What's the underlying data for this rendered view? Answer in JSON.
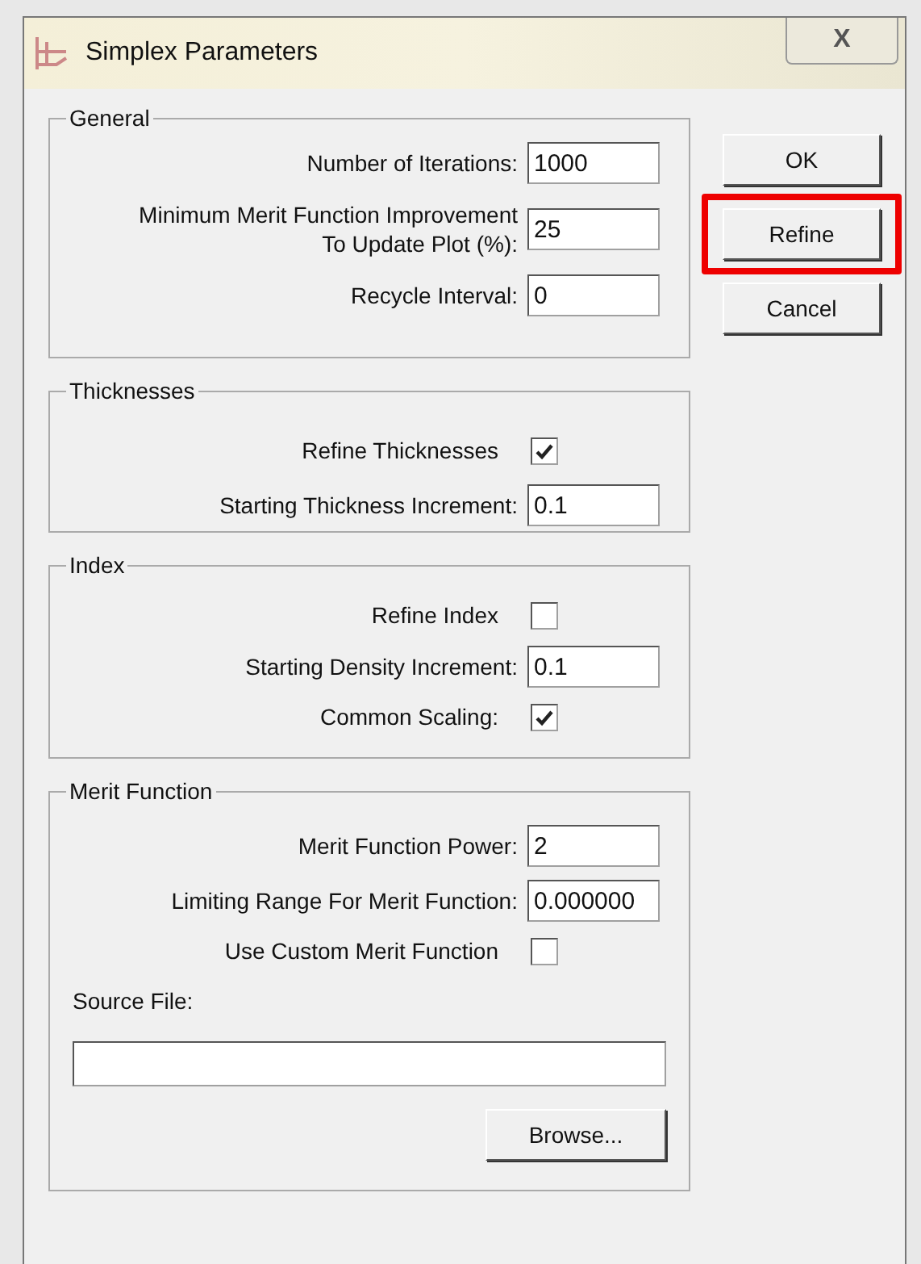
{
  "window": {
    "title": "Simplex Parameters",
    "close": "X"
  },
  "groups": [
    {
      "title": "General",
      "rows": [
        {
          "kind": "text",
          "label": "Number of Iterations:",
          "value": "1000"
        },
        {
          "kind": "text",
          "label": "Minimum Merit Function Improvement To Update Plot (%):",
          "value": "25"
        },
        {
          "kind": "text",
          "label": "Recycle Interval:",
          "value": "0"
        }
      ]
    },
    {
      "title": "Thicknesses",
      "rows": [
        {
          "kind": "checkbox",
          "label": "Refine Thicknesses",
          "checked": true
        },
        {
          "kind": "text",
          "label": "Starting Thickness Increment:",
          "value": "0.1"
        }
      ]
    },
    {
      "title": "Index",
      "rows": [
        {
          "kind": "checkbox",
          "label": "Refine Index",
          "checked": false
        },
        {
          "kind": "text",
          "label": "Starting Density Increment:",
          "value": "0.1"
        },
        {
          "kind": "checkbox",
          "label": "Common Scaling:",
          "checked": true
        }
      ]
    },
    {
      "title": "Merit Function",
      "rows": [
        {
          "kind": "text",
          "label": "Merit Function Power:",
          "value": "2"
        },
        {
          "kind": "text",
          "label": "Limiting Range For Merit Function:",
          "value": "0.000000"
        },
        {
          "kind": "checkbox",
          "label": "Use Custom Merit Function",
          "checked": false
        },
        {
          "kind": "file",
          "label": "Source File:",
          "button": "Browse..."
        }
      ]
    }
  ],
  "buttons": [
    {
      "label": "OK",
      "highlighted": false
    },
    {
      "label": "Refine",
      "highlighted": true
    },
    {
      "label": "Cancel",
      "highlighted": false
    }
  ]
}
